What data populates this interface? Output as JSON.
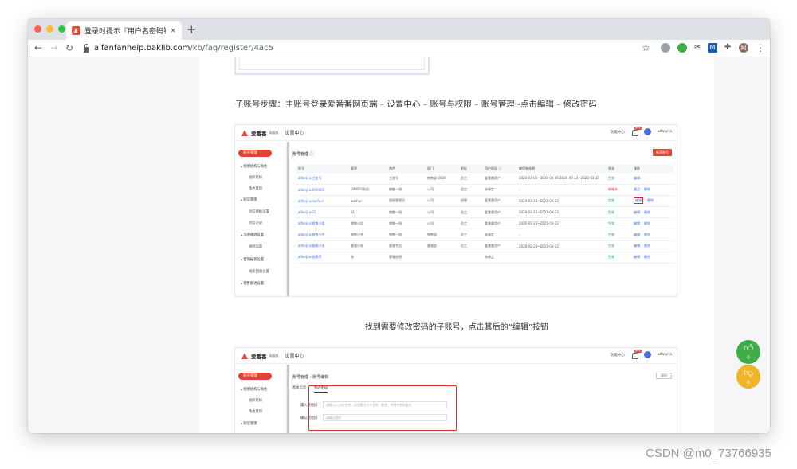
{
  "browser": {
    "tab_title": "登录时提示『用户名密码错误』…",
    "tab_close": "×",
    "new_tab": "+",
    "url_host": "aifanfanhelp.baklib.com",
    "url_path": "/kb/faq/register/4ac5",
    "traffic_lights": [
      "#fe5f57",
      "#febc2e",
      "#28c840"
    ],
    "extension_label": "M",
    "avatar_label": "阿"
  },
  "article": {
    "paragraph": "子账号步骤：主账号登录爱番番网页端 – 设置中心 – 账号与权限 – 账号管理 -点击编辑 – 修改密码",
    "caption": "找到需要修改密码的子账号，点击其后的“编辑”按钮"
  },
  "shot1": {
    "brand": "爱番番",
    "edition": "高级版",
    "header_title": "设置中心",
    "header_right_text": "功能中心",
    "badge": "99+",
    "user": "aifanji-a",
    "sidebar": {
      "active": "账号管理",
      "groups": [
        {
          "label": "组织结构与角色",
          "sub": [
            "组织结构",
            "角色管理"
          ]
        },
        {
          "label": "短信管理",
          "sub": [
            "短信模板设置",
            "短信记录"
          ]
        },
        {
          "label": "沟通规则设置",
          "sub": [
            "规则设置"
          ]
        },
        {
          "label": "营销拓客设置",
          "sub": [
            "线索回收设置"
          ]
        },
        {
          "label": "销售跟进设置",
          "sub": []
        }
      ]
    },
    "main_title": "账号管理 ⓘ",
    "new_button": "新建账号",
    "columns": [
      "账号",
      "昵称",
      "角色",
      "部门",
      "职位",
      "用户权益 ⓘ",
      "使用有效期",
      "状态",
      "操作"
    ],
    "rows": [
      {
        "acct": "aifanji-a 主账号",
        "nick": "",
        "role": "主账号",
        "dept": "销售部-2020",
        "pos": "员工",
        "rights": "爱番番用户",
        "period": "2020-03-06~2021-03-06,2020-03-14~2022-03-15",
        "status": "生效",
        "status_kind": "ok",
        "ops": [
          "编辑"
        ]
      },
      {
        "acct": "aifanji-a:XXX001",
        "nick": "DAVID(测试)",
        "role": "销售一线",
        "dept": "公司",
        "pos": "员工",
        "rights": "未绑定",
        "period": "-",
        "status": "邮箱未",
        "status_kind": "warn",
        "ops": [
          "激活",
          "删除"
        ]
      },
      {
        "acct": "aifanji-a:aochun",
        "nick": "aochun",
        "role": "超级管理员",
        "dept": "公司",
        "pos": "经理",
        "rights": "爱番番用户",
        "period": "2020-03-23~2021-03-23",
        "status": "生效",
        "status_kind": "ok",
        "ops": [
          "编辑",
          "删除"
        ],
        "highlight_edit": true
      },
      {
        "acct": "aifanji-a:01",
        "nick": "01",
        "role": "销售一线",
        "dept": "公司",
        "pos": "员工",
        "rights": "爱番番用户",
        "period": "2020-03-23~2021-03-23",
        "status": "生效",
        "status_kind": "ok",
        "ops": [
          "编辑",
          "删除"
        ]
      },
      {
        "acct": "aifanji-a:销售小组",
        "nick": "销售小组",
        "role": "销售一线",
        "dept": "公司",
        "pos": "员工",
        "rights": "爱番番用户",
        "period": "2020-03-23~2021-03-23",
        "status": "生效",
        "status_kind": "ok",
        "ops": [
          "编辑",
          "删除"
        ]
      },
      {
        "acct": "aifanji-a:销售小齐",
        "nick": "销售小齐",
        "role": "销售一线",
        "dept": "销售部",
        "pos": "员工",
        "rights": "未绑定",
        "period": "-",
        "status": "生效",
        "status_kind": "ok",
        "ops": [
          "编辑",
          "删除"
        ]
      },
      {
        "acct": "aifanji-a:客服小张",
        "nick": "客服小张",
        "role": "客服专员",
        "dept": "客服部",
        "pos": "员工",
        "rights": "爱番番用户",
        "period": "2020-03-23~2021-03-22",
        "status": "生效",
        "status_kind": "ok",
        "ops": [
          "编辑",
          "删除"
        ]
      },
      {
        "acct": "aifanji-a:张燕萍",
        "nick": "张",
        "role": "客服经理",
        "dept": "",
        "pos": "",
        "rights": "未绑定",
        "period": "",
        "status": "生效",
        "status_kind": "ok",
        "ops": [
          "编辑",
          "删除"
        ]
      }
    ]
  },
  "shot2": {
    "brand": "爱番番",
    "edition": "高级版",
    "header_title": "设置中心",
    "header_right_text": "功能中心",
    "badge": "99+",
    "user": "aifanji-a",
    "sidebar_active": "账号管理",
    "sidebar_items": [
      "组织结构与角色",
      "组织结构",
      "角色管理",
      "短信管理"
    ],
    "breadcrumb": "账号管理 › 账号编辑",
    "back_button": "返回",
    "tabs": [
      "基本信息",
      "修改密码"
    ],
    "fields": [
      {
        "label": "输入新密码",
        "placeholder": "请输入6-20位字符，必须是大小写字母、数字、特殊字符的组合"
      },
      {
        "label": "确认新密码",
        "placeholder": "请确认密码"
      }
    ]
  },
  "vote": {
    "up_count": "0",
    "down_count": "0",
    "up_color": "#3fae49",
    "down_color": "#f0b429"
  },
  "watermark": "CSDN @m0_73766935"
}
